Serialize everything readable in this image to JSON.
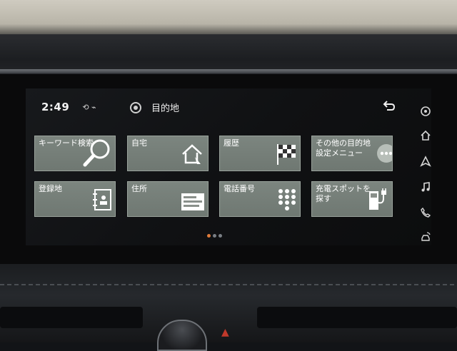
{
  "status": {
    "time": "2:49"
  },
  "header": {
    "title": "目的地"
  },
  "tiles": [
    {
      "label": "キーワード検索",
      "icon": "magnifier-icon"
    },
    {
      "label": "自宅",
      "icon": "home-icon"
    },
    {
      "label": "履歴",
      "icon": "checkered-flag-icon"
    },
    {
      "label": "その他の目的地\n設定メニュー",
      "icon": "more-dots-icon"
    },
    {
      "label": "登録地",
      "icon": "address-book-icon"
    },
    {
      "label": "住所",
      "icon": "address-card-icon"
    },
    {
      "label": "電話番号",
      "icon": "keypad-icon"
    },
    {
      "label": "充電スポットを\n探す",
      "icon": "charger-plug-icon"
    }
  ],
  "pager": {
    "pages": 3,
    "active": 0
  },
  "sidebar": [
    {
      "icon": "settings-gear-icon"
    },
    {
      "icon": "home-icon"
    },
    {
      "icon": "navigation-arrow-icon"
    },
    {
      "icon": "music-note-icon"
    },
    {
      "icon": "phone-icon"
    },
    {
      "icon": "connected-car-icon"
    }
  ],
  "colors": {
    "tile": "#737c76",
    "pager_active": "#e07b3a",
    "background": "#101113"
  }
}
